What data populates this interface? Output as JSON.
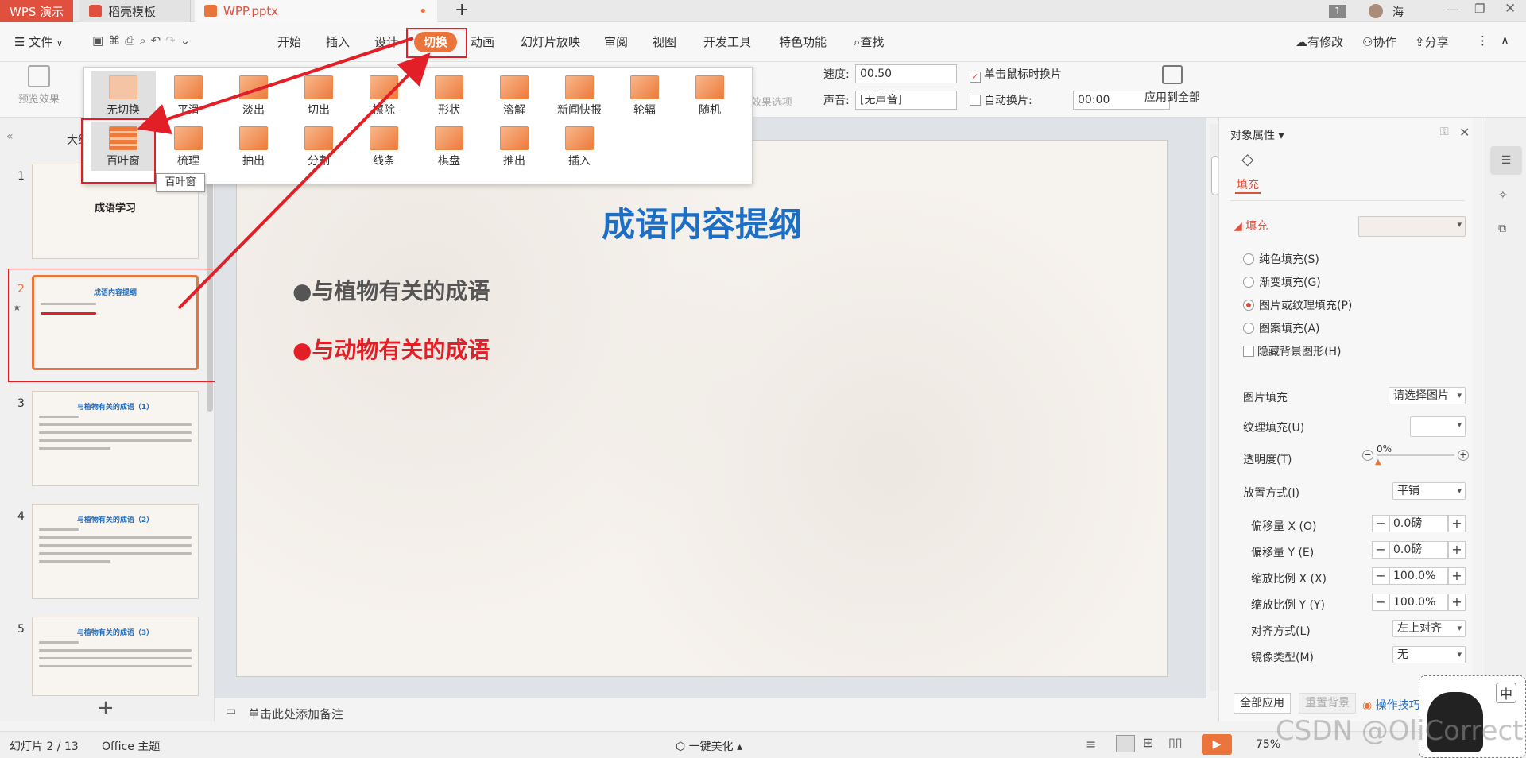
{
  "titlebar": {
    "tabs": [
      {
        "label": "WPS 演示"
      },
      {
        "label": "稻壳模板"
      },
      {
        "label": "WPP.pptx"
      }
    ],
    "new_tab": "+",
    "page_indicator": "1",
    "user_name": "海",
    "modified_dot": "•"
  },
  "menubar": {
    "file": "文件",
    "items": [
      "开始",
      "插入",
      "设计",
      "切换",
      "动画",
      "幻灯片放映",
      "审阅",
      "视图",
      "开发工具",
      "特色功能"
    ],
    "active": "切换",
    "search": "查找",
    "right": [
      "有修改",
      "协作",
      "分享"
    ]
  },
  "ribbon": {
    "preview": "预览效果",
    "effect_options": "效果选项",
    "speed_label": "速度:",
    "speed_value": "00.50",
    "sound_label": "声音:",
    "sound_value": "[无声音]",
    "click_switch": "单击鼠标时换片",
    "auto_switch": "自动换片:",
    "auto_value": "00:00",
    "apply_all": "应用到全部"
  },
  "gallery": {
    "row1": [
      "无切换",
      "平滑",
      "淡出",
      "切出",
      "擦除",
      "形状",
      "溶解",
      "新闻快报",
      "轮辐",
      "随机"
    ],
    "row2": [
      "百叶窗",
      "梳理",
      "抽出",
      "分割",
      "线条",
      "棋盘",
      "推出",
      "插入"
    ],
    "tooltip": "百叶窗"
  },
  "leftpanel": {
    "outline_tab": "大纲",
    "slides": [
      {
        "num": "1",
        "title": "成语学习"
      },
      {
        "num": "2",
        "title": "成语内容提纲"
      },
      {
        "num": "3",
        "title": "与植物有关的成语（1）"
      },
      {
        "num": "4",
        "title": "与植物有关的成语（2）"
      },
      {
        "num": "5",
        "title": "与植物有关的成语（3）"
      }
    ],
    "add": "+"
  },
  "slide": {
    "title": "成语内容提纲",
    "bullets": [
      "●与植物有关的成语",
      "●与动物有关的成语"
    ],
    "bullet_colors": [
      "#555555",
      "#e21f26"
    ]
  },
  "notes": {
    "placeholder": "单击此处添加备注"
  },
  "rightpanel": {
    "header": "对象属性",
    "tab": "填充",
    "section": "填充",
    "options": [
      "纯色填充(S)",
      "渐变填充(G)",
      "图片或纹理填充(P)",
      "图案填充(A)",
      "隐藏背景图形(H)"
    ],
    "selected_option": "图片或纹理填充(P)",
    "picture_fill_label": "图片填充",
    "picture_fill_value": "请选择图片",
    "texture_label": "纹理填充(U)",
    "transparency_label": "透明度(T)",
    "transparency_value": "0%",
    "placement_label": "放置方式(I)",
    "placement_value": "平铺",
    "offset_x_label": "偏移量 X (O)",
    "offset_x_value": "0.0磅",
    "offset_y_label": "偏移量 Y (E)",
    "offset_y_value": "0.0磅",
    "scale_x_label": "缩放比例 X (X)",
    "scale_x_value": "100.0%",
    "scale_y_label": "缩放比例 Y (Y)",
    "scale_y_value": "100.0%",
    "align_label": "对齐方式(L)",
    "align_value": "左上对齐",
    "mirror_label": "镜像类型(M)",
    "mirror_value": "无",
    "apply_all": "全部应用",
    "reset_bg": "重置背景",
    "tips": "操作技巧"
  },
  "statusbar": {
    "slide_info": "幻灯片 2 / 13",
    "theme": "Office 主题",
    "beautify": "一键美化",
    "zoom": "75%"
  },
  "ime": {
    "label": "中"
  },
  "watermark": "CSDN @OliCorrect",
  "colors": {
    "accent": "#e9743c",
    "highlight": "#e21f26",
    "title_blue": "#1c6fc5"
  }
}
